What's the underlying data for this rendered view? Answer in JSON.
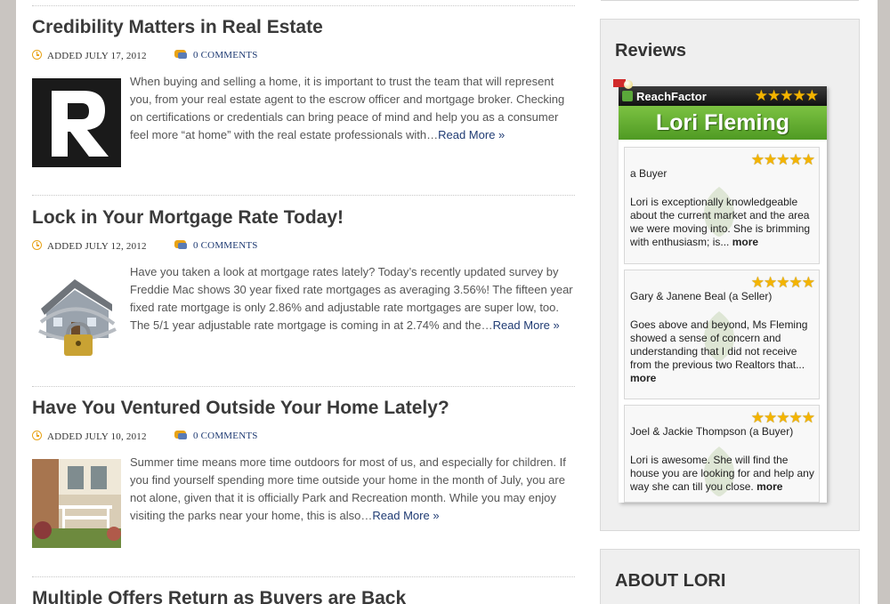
{
  "posts": [
    {
      "title": "Credibility Matters in Real Estate",
      "date": "ADDED JULY 17, 2012",
      "comments": "0 COMMENTS",
      "excerpt": "When buying and selling a home, it is important to trust the team that will represent you, from your real estate agent to the escrow officer and mortgage broker. Checking on certifications or credentials can bring peace of mind and help you as a consumer feel more “at home” with the real estate professionals with…",
      "read_more": "Read More »"
    },
    {
      "title": "Lock in Your Mortgage Rate Today!",
      "date": "ADDED JULY 12, 2012",
      "comments": "0 COMMENTS",
      "excerpt": "Have you taken a look at mortgage rates lately? Today’s recently updated survey by Freddie Mac shows 30 year fixed rate mortgages as averaging 3.56%! The fifteen year fixed rate mortgage is only 2.86% and adjustable rate mortgages are super low, too. The 5/1 year adjustable rate mortgage is coming in at 2.74% and the…",
      "read_more": "Read More »"
    },
    {
      "title": "Have You Ventured Outside Your Home Lately?",
      "date": "ADDED JULY 10, 2012",
      "comments": "0 COMMENTS",
      "excerpt": "Summer time means more time outdoors for most of us, and especially for children. If you find yourself spending more time outside your home in the month of July, you are not alone, given that it is officially Park and Recreation month. While you may enjoy visiting the parks near your home, this is also…",
      "read_more": "Read More »"
    },
    {
      "title": "Multiple Offers Return as Buyers are Back"
    }
  ],
  "sidebar": {
    "reviews_title": "Reviews",
    "about_title": "ABOUT LORI",
    "reachfactor": {
      "brand": "ReachFactor",
      "agent_name": "Lori Fleming",
      "reviews": [
        {
          "author": "a Buyer",
          "text": "Lori is exceptionally knowledgeable about the current market and the area we were moving into. She is brimming with enthusiasm; is...",
          "more": "more"
        },
        {
          "author": "Gary & Janene Beal (a Seller)",
          "text": "Goes above and beyond, Ms Fleming showed a sense of concern and understanding that I did not receive from the previous two Realtors that...",
          "more": "more"
        },
        {
          "author": "Joel & Jackie Thompson (a Buyer)",
          "text": "Lori is awesome. She will find the house you are looking for and help any way she can till you close.",
          "more": "more"
        }
      ]
    }
  },
  "icons": {
    "date": "clock-icon",
    "comments": "comment-bubble-icon",
    "rating": "star-icon"
  },
  "colors": {
    "link": "#1f3b73",
    "accent_orange": "#e8a317",
    "reachfactor_green": "#5aa83a"
  }
}
